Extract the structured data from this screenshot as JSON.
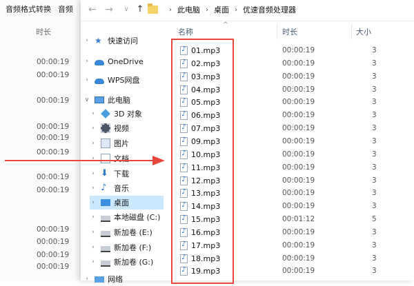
{
  "background_app": {
    "tabs": [
      "音频格式转换",
      "音频"
    ],
    "column_header": "时长",
    "durations": [
      "00:00:19",
      "00:00:19",
      "00:00:19",
      "00:00:19",
      "00:00:19",
      "00:00:19",
      "00:00:19",
      "00:00:19",
      "00:00:19",
      "00:00:19",
      "00:00:19",
      "00:00:19"
    ]
  },
  "explorer": {
    "toolbar": {
      "back_icon": "←",
      "forward_icon": "→",
      "dropdown_icon": "∨",
      "up_icon": "↑",
      "breadcrumb": [
        "此电脑",
        "桌面",
        "优速音频处理器"
      ],
      "sep": "›"
    },
    "nav_pane": {
      "items": [
        {
          "label": "快速访问",
          "icon": "star-icon"
        },
        {
          "label": "OneDrive",
          "icon": "cloud-icon"
        },
        {
          "label": "WPS网盘",
          "icon": "cloud-icon"
        },
        {
          "label": "此电脑",
          "icon": "computer-icon"
        },
        {
          "label": "3D 对象",
          "icon": "cube-icon"
        },
        {
          "label": "视频",
          "icon": "film-icon"
        },
        {
          "label": "图片",
          "icon": "picture-icon"
        },
        {
          "label": "文档",
          "icon": "document-icon"
        },
        {
          "label": "下载",
          "icon": "download-icon"
        },
        {
          "label": "音乐",
          "icon": "music-icon"
        },
        {
          "label": "桌面",
          "icon": "desktop-icon"
        },
        {
          "label": "本地磁盘 (C:)",
          "icon": "drive-icon"
        },
        {
          "label": "新加卷 (E:)",
          "icon": "drive-icon"
        },
        {
          "label": "新加卷 (F:)",
          "icon": "drive-icon"
        },
        {
          "label": "新加卷 (G:)",
          "icon": "drive-icon"
        },
        {
          "label": "网络",
          "icon": "network-icon"
        }
      ]
    },
    "columns": {
      "name": "名称",
      "duration": "时长",
      "size": "大小"
    },
    "sort_indicator": "^",
    "files": [
      {
        "name": "01.mp3",
        "duration": "00:00:19",
        "size": "3"
      },
      {
        "name": "02.mp3",
        "duration": "00:00:19",
        "size": "3"
      },
      {
        "name": "03.mp3",
        "duration": "00:00:19",
        "size": "3"
      },
      {
        "name": "04.mp3",
        "duration": "00:00:19",
        "size": "3"
      },
      {
        "name": "05.mp3",
        "duration": "00:00:19",
        "size": "3"
      },
      {
        "name": "06.mp3",
        "duration": "00:00:19",
        "size": "3"
      },
      {
        "name": "07.mp3",
        "duration": "00:00:19",
        "size": "3"
      },
      {
        "name": "09.mp3",
        "duration": "00:00:19",
        "size": "3"
      },
      {
        "name": "10.mp3",
        "duration": "00:00:19",
        "size": "3"
      },
      {
        "name": "11.mp3",
        "duration": "00:00:19",
        "size": "3"
      },
      {
        "name": "12.mp3",
        "duration": "00:00:19",
        "size": "3"
      },
      {
        "name": "13.mp3",
        "duration": "00:00:19",
        "size": "3"
      },
      {
        "name": "14.mp3",
        "duration": "00:00:19",
        "size": "3"
      },
      {
        "name": "15.mp3",
        "duration": "00:01:12",
        "size": "5"
      },
      {
        "name": "16.mp3",
        "duration": "00:00:19",
        "size": "3"
      },
      {
        "name": "17.mp3",
        "duration": "00:00:19",
        "size": "3"
      },
      {
        "name": "18.mp3",
        "duration": "00:00:19",
        "size": "3"
      },
      {
        "name": "19.mp3",
        "duration": "00:00:19",
        "size": "3"
      }
    ]
  },
  "annotations": {
    "highlight_color": "#e8473e",
    "arrow_color": "#e8473e"
  }
}
